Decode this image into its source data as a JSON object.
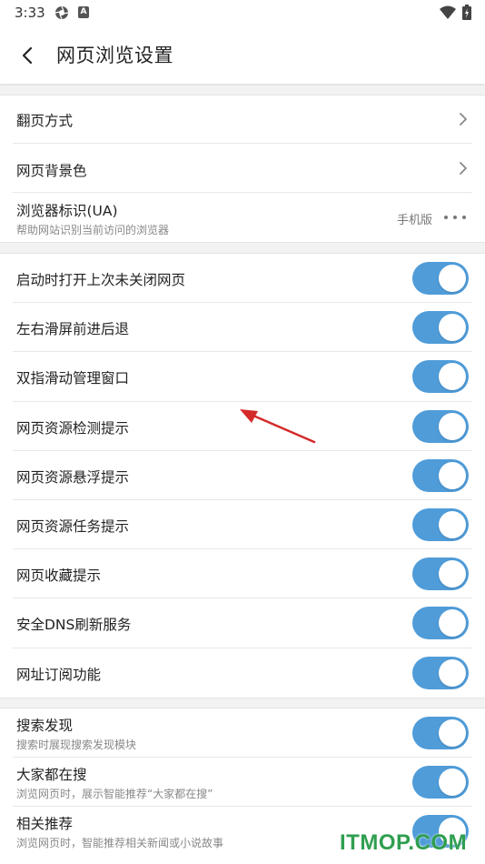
{
  "status_bar": {
    "time": "3:33",
    "icons": [
      "aperture-icon",
      "a-letter-icon",
      "wifi-icon",
      "battery-charging-icon"
    ],
    "a_icon_letter": "A"
  },
  "header": {
    "back_icon": "back-arrow-icon",
    "title": "网页浏览设置"
  },
  "general": {
    "page_turn_label": "翻页方式",
    "background_label": "网页背景色",
    "ua_label": "浏览器标识(UA)",
    "ua_sub": "帮助网站识别当前访问的浏览器",
    "ua_value": "手机版"
  },
  "toggles": [
    {
      "label": "启动时打开上次未关闭网页",
      "on": true
    },
    {
      "label": "左右滑屏前进后退",
      "on": true
    },
    {
      "label": "双指滑动管理窗口",
      "on": true
    },
    {
      "label": "网页资源检测提示",
      "on": true
    },
    {
      "label": "网页资源悬浮提示",
      "on": true
    },
    {
      "label": "网页资源任务提示",
      "on": true
    },
    {
      "label": "网页收藏提示",
      "on": true
    },
    {
      "label": "安全DNS刷新服务",
      "on": true
    },
    {
      "label": "网址订阅功能",
      "on": true
    }
  ],
  "discovery": [
    {
      "label": "搜索发现",
      "sub": "搜索时展现搜索发现模块",
      "on": true
    },
    {
      "label": "大家都在搜",
      "sub": "浏览网页时，展示智能推荐“大家都在搜”",
      "on": true
    },
    {
      "label": "相关推荐",
      "sub": "浏览网页时，智能推荐相关新闻或小说故事",
      "on": true
    }
  ],
  "colors": {
    "toggle_on": "#4f9cd9",
    "annotation_arrow": "#d42a2a",
    "watermark": "#2f9e4f"
  },
  "watermark": "ITMOP.COM"
}
